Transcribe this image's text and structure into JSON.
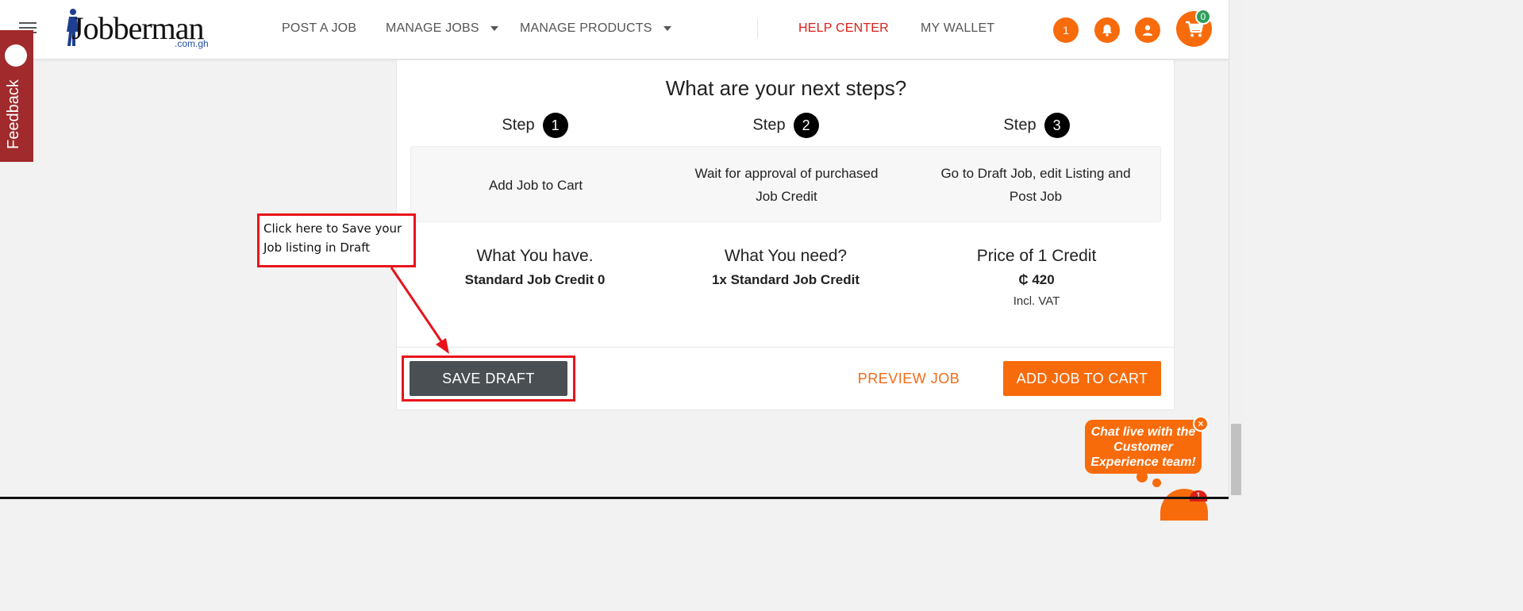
{
  "header": {
    "logo_text": "Jobberman",
    "logo_sub": ".com.gh",
    "nav": {
      "post_job": "POST A JOB",
      "manage_jobs": "MANAGE JOBS",
      "manage_products": "MANAGE PRODUCTS",
      "help_center": "HELP CENTER",
      "my_wallet": "MY WALLET"
    },
    "notification_count": "1",
    "cart_count": "0",
    "icons": [
      "menu-icon",
      "bell-icon",
      "user-icon",
      "cart-icon"
    ]
  },
  "feedback": {
    "label": "Feedback"
  },
  "next_steps": {
    "title": "What are your next steps?",
    "step_word": "Step",
    "steps": [
      {
        "number": "1",
        "text": "Add Job to Cart"
      },
      {
        "number": "2",
        "text": "Wait for approval of purchased Job Credit"
      },
      {
        "number": "3",
        "text": "Go to Draft Job, edit Listing and Post Job"
      }
    ]
  },
  "credits": {
    "have_title": "What You have.",
    "have_value": "Standard Job Credit 0",
    "need_title": "What You need?",
    "need_value": "1x Standard Job Credit",
    "price_title": "Price of 1 Credit",
    "price_value": "₵ 420",
    "price_note": "Incl. VAT"
  },
  "actions": {
    "save_draft": "SAVE DRAFT",
    "preview_job": "PREVIEW JOB",
    "add_to_cart": "ADD JOB TO CART"
  },
  "annotation": {
    "text": "Click here to Save your Job listing in Draft",
    "color": "#e8141b"
  },
  "chat": {
    "message": "Chat live with the Customer Experience team!",
    "close": "×",
    "badge": "1"
  },
  "colors": {
    "brand_orange": "#f76b0b",
    "help_red": "#d9211a",
    "save_gray": "#4a4f53",
    "feedback_red": "#a02a2c"
  }
}
